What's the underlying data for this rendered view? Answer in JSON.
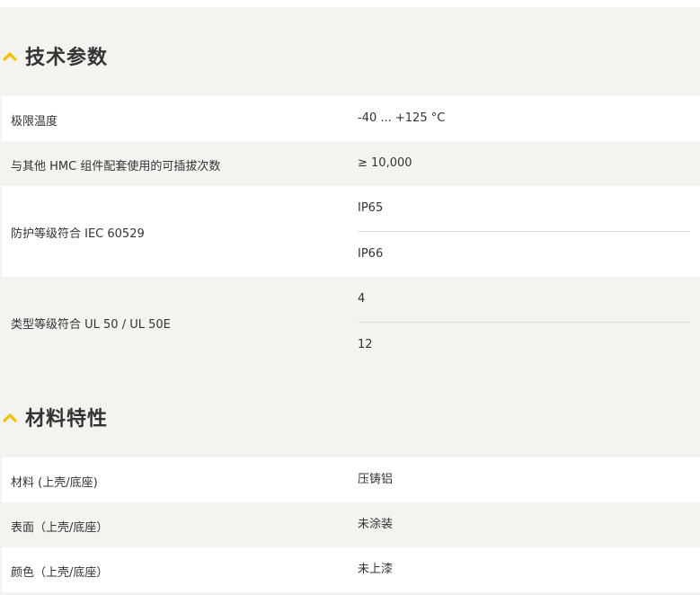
{
  "sections": [
    {
      "title": "技术参数",
      "rows": [
        {
          "label": "极限温度",
          "values": [
            "-40 ... +125 °C"
          ]
        },
        {
          "label": "与其他 HMC 组件配套使用的可插拔次数",
          "values": [
            "≥ 10,000"
          ]
        },
        {
          "label": "防护等级符合 IEC 60529",
          "values": [
            "IP65",
            "IP66"
          ]
        },
        {
          "label": "类型等级符合 UL 50 / UL 50E",
          "values": [
            "4",
            "12"
          ]
        }
      ]
    },
    {
      "title": "材料特性",
      "rows": [
        {
          "label": "材料 (上壳/底座)",
          "values": [
            "压铸铝"
          ]
        },
        {
          "label": "表面（上壳/底座）",
          "values": [
            "未涂装"
          ]
        },
        {
          "label": "颜色（上壳/底座）",
          "values": [
            "未上漆"
          ]
        }
      ]
    }
  ],
  "colors": {
    "accent": "#f2c200",
    "row_white": "#ffffff",
    "row_grey": "#f4f3f0"
  },
  "icons": {
    "section_toggle": "chevron-up-icon"
  }
}
